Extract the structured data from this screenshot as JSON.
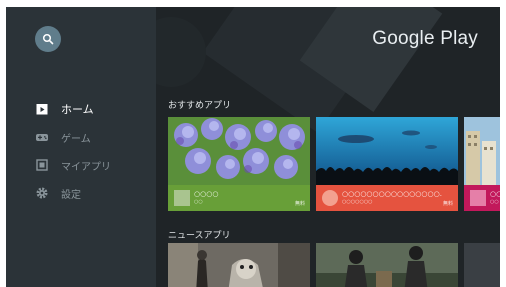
{
  "sidebar": {
    "items": [
      {
        "label": "ホーム",
        "icon": "home-icon",
        "active": true
      },
      {
        "label": "ゲーム",
        "icon": "gamepad-icon",
        "active": false
      },
      {
        "label": "マイアプリ",
        "icon": "apps-icon",
        "active": false
      },
      {
        "label": "設定",
        "icon": "gear-icon",
        "active": false
      }
    ]
  },
  "header": {
    "brand": "Google Play"
  },
  "sections": {
    "recommended": {
      "title": "おすすめアプリ",
      "cards": [
        {
          "title": "○○○○",
          "subtitle": "○○",
          "price": "無料",
          "meta_color": "#689f38"
        },
        {
          "title": "○○○○○○○○○○○○○○○○.",
          "subtitle": "○○○○○○○",
          "price": "無料",
          "meta_color": "#e5533f"
        },
        {
          "title": "○○○",
          "subtitle": "○○",
          "price": "",
          "meta_color": "#c2185b"
        }
      ]
    },
    "news": {
      "title": "ニュースアプリ"
    }
  },
  "colors": {
    "sidebar_bg": "#2b3338",
    "main_bg": "#1f2427",
    "search_button": "#607d8b",
    "active_text": "#ffffff",
    "inactive_text": "#8a959b"
  }
}
